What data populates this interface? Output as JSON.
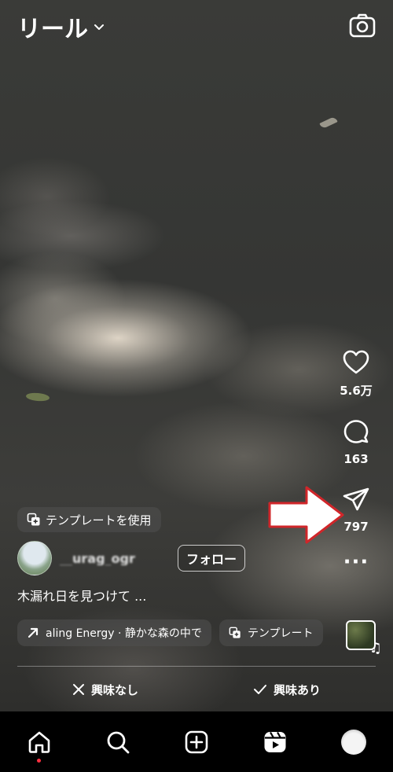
{
  "header": {
    "title": "リール"
  },
  "actions": {
    "likes": "5.6万",
    "comments": "163",
    "shares": "797"
  },
  "template_chip": "テンプレートを使用",
  "post": {
    "username": "__urag_ogr",
    "follow_label": "フォロー",
    "caption": "木漏れ日を見つけて ..."
  },
  "chips": {
    "music": "aling Energy · 静かな森の中で",
    "template": "テンプレート"
  },
  "feedback": {
    "not_interested": "興味なし",
    "interested": "興味あり"
  },
  "colors": {
    "arrow_fill": "#ffffff",
    "arrow_stroke": "#d0262a",
    "notification_dot": "#ff3040"
  },
  "icons": [
    "chevron-down-icon",
    "camera-icon",
    "heart-icon",
    "comment-icon",
    "send-icon",
    "more-icon",
    "music-note-icon",
    "trend-arrow-icon",
    "template-icon",
    "close-icon",
    "check-icon",
    "home-icon",
    "search-icon",
    "create-icon",
    "reels-icon"
  ]
}
